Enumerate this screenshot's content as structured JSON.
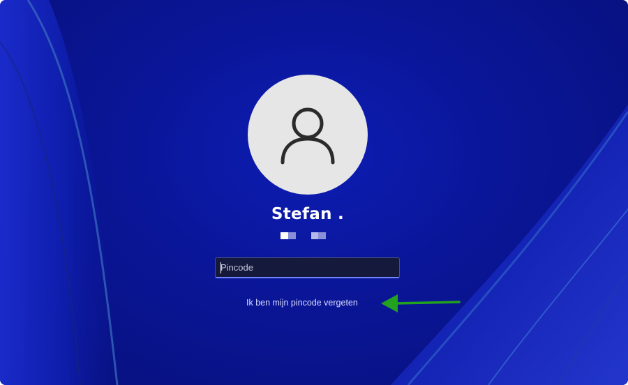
{
  "login": {
    "username": "Stefan .",
    "pin_placeholder": "Pincode",
    "pin_value": "",
    "forgot_pin_label": "Ik ben mijn pincode vergeten"
  },
  "icons": {
    "avatar": "user-silhouette-icon",
    "annotation": "green-arrow-left-icon"
  },
  "colors": {
    "background": "#0a1699",
    "avatar_bg": "#e6e6e6",
    "avatar_icon": "#2b2b2b",
    "link_text": "#d8dcff",
    "field_accent": "#6f86ff",
    "annotation_arrow": "#22a21f"
  }
}
